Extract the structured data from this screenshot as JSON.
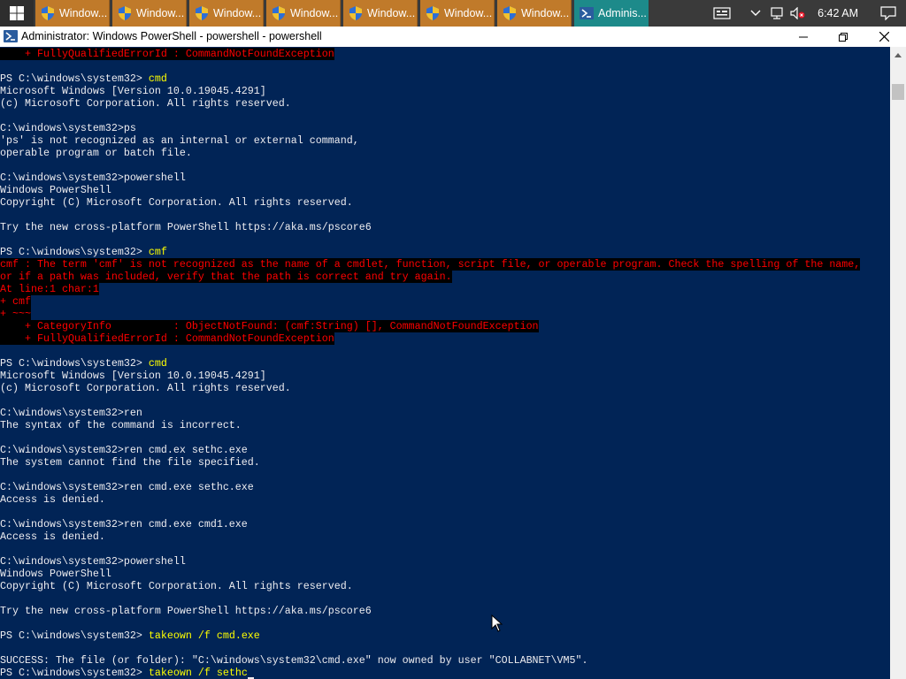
{
  "taskbar": {
    "buttons": [
      {
        "label": "Window..."
      },
      {
        "label": "Window..."
      },
      {
        "label": "Window..."
      },
      {
        "label": "Window..."
      },
      {
        "label": "Window..."
      },
      {
        "label": "Window..."
      },
      {
        "label": "Window..."
      },
      {
        "label": "Adminis..."
      }
    ],
    "time": "6:42 AM"
  },
  "window": {
    "title": "Administrator: Windows PowerShell - powershell - powershell"
  },
  "console": {
    "lines": [
      {
        "text": "    + FullyQualifiedErrorId : CommandNotFoundException",
        "kind": "err"
      },
      {
        "text": "",
        "kind": "blank"
      },
      {
        "prompt": "PS C:\\windows\\system32> ",
        "cmd": "cmd",
        "kind": "ps"
      },
      {
        "text": "Microsoft Windows [Version 10.0.19045.4291]",
        "kind": "out"
      },
      {
        "text": "(c) Microsoft Corporation. All rights reserved.",
        "kind": "out"
      },
      {
        "text": "",
        "kind": "blank"
      },
      {
        "text": "C:\\windows\\system32>ps",
        "kind": "out"
      },
      {
        "text": "'ps' is not recognized as an internal or external command,",
        "kind": "out"
      },
      {
        "text": "operable program or batch file.",
        "kind": "out"
      },
      {
        "text": "",
        "kind": "blank"
      },
      {
        "text": "C:\\windows\\system32>powershell",
        "kind": "out"
      },
      {
        "text": "Windows PowerShell",
        "kind": "out"
      },
      {
        "text": "Copyright (C) Microsoft Corporation. All rights reserved.",
        "kind": "out"
      },
      {
        "text": "",
        "kind": "blank"
      },
      {
        "text": "Try the new cross-platform PowerShell https://aka.ms/pscore6",
        "kind": "out"
      },
      {
        "text": "",
        "kind": "blank"
      },
      {
        "prompt": "PS C:\\windows\\system32> ",
        "cmd": "cmf",
        "kind": "ps"
      },
      {
        "text": "cmf : The term 'cmf' is not recognized as the name of a cmdlet, function, script file, or operable program. Check the spelling of the name,",
        "kind": "err"
      },
      {
        "text": "or if a path was included, verify that the path is correct and try again.",
        "kind": "err"
      },
      {
        "text": "At line:1 char:1",
        "kind": "err"
      },
      {
        "text": "+ cmf",
        "kind": "err"
      },
      {
        "text": "+ ~~~",
        "kind": "err"
      },
      {
        "text": "    + CategoryInfo          : ObjectNotFound: (cmf:String) [], CommandNotFoundException",
        "kind": "err"
      },
      {
        "text": "    + FullyQualifiedErrorId : CommandNotFoundException",
        "kind": "err"
      },
      {
        "text": "",
        "kind": "blank"
      },
      {
        "prompt": "PS C:\\windows\\system32> ",
        "cmd": "cmd",
        "kind": "ps"
      },
      {
        "text": "Microsoft Windows [Version 10.0.19045.4291]",
        "kind": "out"
      },
      {
        "text": "(c) Microsoft Corporation. All rights reserved.",
        "kind": "out"
      },
      {
        "text": "",
        "kind": "blank"
      },
      {
        "text": "C:\\windows\\system32>ren",
        "kind": "out"
      },
      {
        "text": "The syntax of the command is incorrect.",
        "kind": "out"
      },
      {
        "text": "",
        "kind": "blank"
      },
      {
        "text": "C:\\windows\\system32>ren cmd.ex sethc.exe",
        "kind": "out"
      },
      {
        "text": "The system cannot find the file specified.",
        "kind": "out"
      },
      {
        "text": "",
        "kind": "blank"
      },
      {
        "text": "C:\\windows\\system32>ren cmd.exe sethc.exe",
        "kind": "out"
      },
      {
        "text": "Access is denied.",
        "kind": "out"
      },
      {
        "text": "",
        "kind": "blank"
      },
      {
        "text": "C:\\windows\\system32>ren cmd.exe cmd1.exe",
        "kind": "out"
      },
      {
        "text": "Access is denied.",
        "kind": "out"
      },
      {
        "text": "",
        "kind": "blank"
      },
      {
        "text": "C:\\windows\\system32>powershell",
        "kind": "out"
      },
      {
        "text": "Windows PowerShell",
        "kind": "out"
      },
      {
        "text": "Copyright (C) Microsoft Corporation. All rights reserved.",
        "kind": "out"
      },
      {
        "text": "",
        "kind": "blank"
      },
      {
        "text": "Try the new cross-platform PowerShell https://aka.ms/pscore6",
        "kind": "out"
      },
      {
        "text": "",
        "kind": "blank"
      },
      {
        "prompt": "PS C:\\windows\\system32> ",
        "cmd": "takeown /f cmd.exe",
        "kind": "ps"
      },
      {
        "text": "",
        "kind": "blank"
      },
      {
        "text": "SUCCESS: The file (or folder): \"C:\\windows\\system32\\cmd.exe\" now owned by user \"COLLABNET\\VM5\".",
        "kind": "out"
      },
      {
        "prompt": "PS C:\\windows\\system32> ",
        "cmd": "takeown /f sethc",
        "kind": "ps",
        "cursor": true
      }
    ]
  },
  "colors": {
    "console_bg": "#012456",
    "console_fg": "#eeedf0",
    "error_fg": "#ff0000",
    "command_fg": "#ffff00",
    "taskbar_button": "#c07a2a",
    "taskbar_active": "#1d8a8a"
  }
}
